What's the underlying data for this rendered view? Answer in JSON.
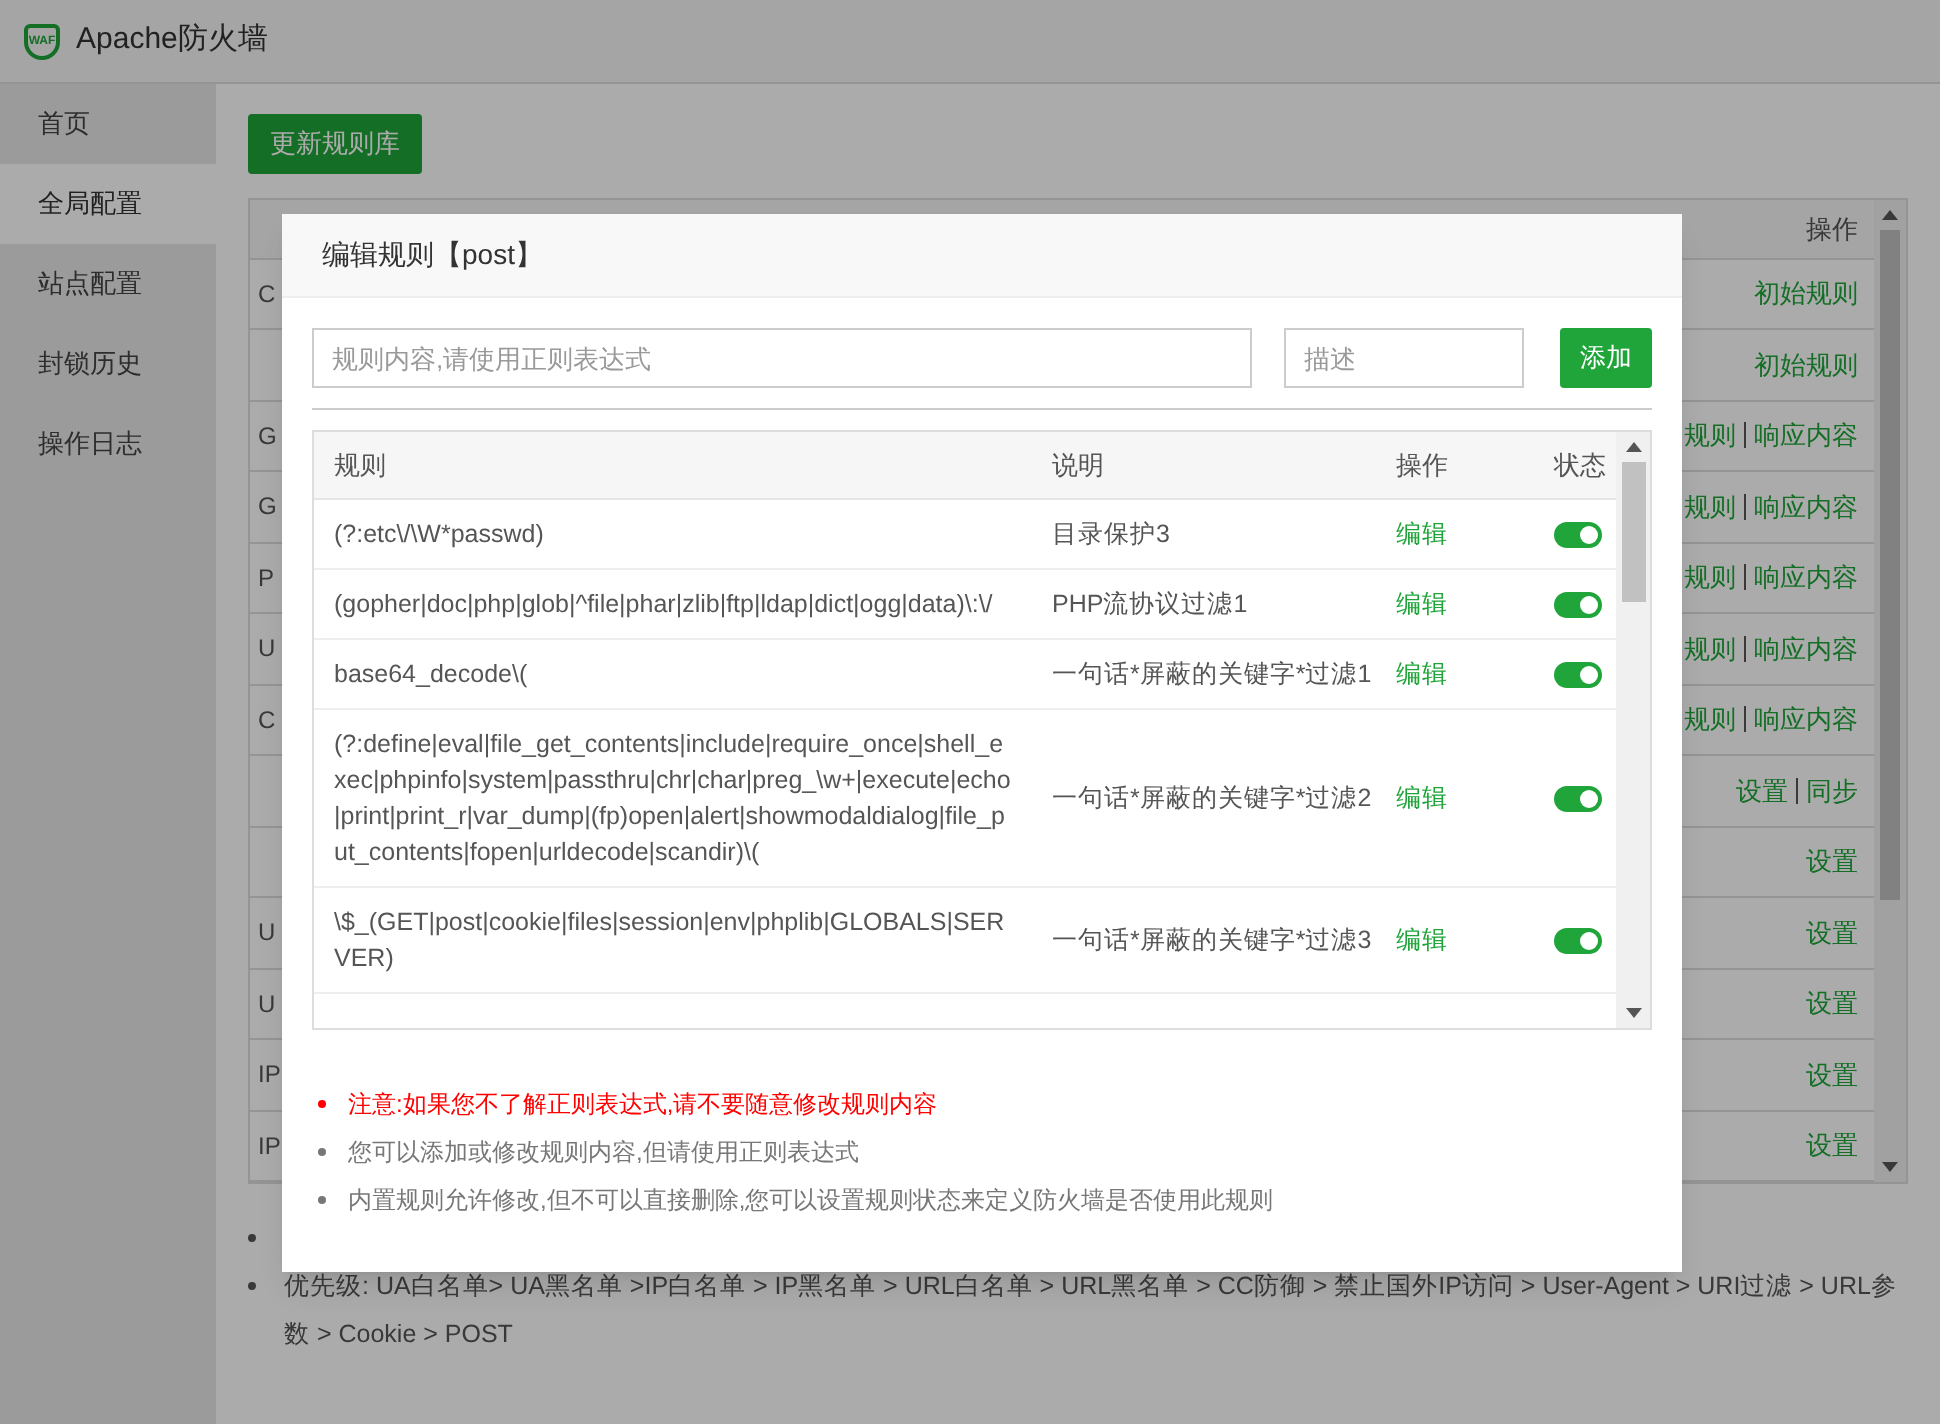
{
  "app": {
    "logo_text": "WAF",
    "title": "Apache防火墙"
  },
  "sidebar": {
    "items": [
      {
        "label": "首页",
        "selected": false
      },
      {
        "label": "全局配置",
        "selected": true
      },
      {
        "label": "站点配置",
        "selected": false
      },
      {
        "label": "封锁历史",
        "selected": false
      },
      {
        "label": "操作日志",
        "selected": false
      }
    ]
  },
  "update_button": "更新规则库",
  "background_table": {
    "columns": [
      "操作"
    ],
    "rows": [
      {
        "name": "C",
        "actions": [
          "初始规则"
        ]
      },
      {
        "actions": [
          "初始规则"
        ]
      },
      {
        "name": "G",
        "actions": [
          "规则",
          "响应内容"
        ]
      },
      {
        "name": "G",
        "actions": [
          "规则",
          "响应内容"
        ]
      },
      {
        "name": "P",
        "actions": [
          "规则",
          "响应内容"
        ]
      },
      {
        "name": "U",
        "actions": [
          "规则",
          "响应内容"
        ]
      },
      {
        "name": "C",
        "actions": [
          "规则",
          "响应内容"
        ]
      },
      {
        "actions": [
          "设置",
          "同步"
        ]
      },
      {
        "actions": [
          "设置"
        ]
      },
      {
        "name": "U",
        "actions": [
          "设置"
        ]
      },
      {
        "name": "U",
        "actions": [
          "设置"
        ]
      },
      {
        "name": "IP",
        "actions": [
          "设置"
        ]
      },
      {
        "name": "IP",
        "actions": [
          "设置"
        ]
      }
    ]
  },
  "footer_notes": [
    "优先级: UA白名单> UA黑名单 >IP白名单 > IP黑名单 > URL白名单 > URL黑名单 > CC防御 > 禁止国外IP访问 > User-Agent > URI过滤 > URL参数 > Cookie > POST"
  ],
  "dialog": {
    "title": "编辑规则【post】",
    "rule_field": {
      "placeholder": "规则内容,请使用正则表达式"
    },
    "desc_field": {
      "placeholder": "描述"
    },
    "add_button": "添加",
    "columns": [
      "规则",
      "说明",
      "操作",
      "状态"
    ],
    "rules": [
      {
        "rule": "(?:etc\\/\\W*passwd)",
        "desc": "目录保护3",
        "action": "编辑",
        "on": true
      },
      {
        "rule": "(gopher|doc|php|glob|^file|phar|zlib|ftp|ldap|dict|ogg|data)\\:\\/",
        "desc": "PHP流协议过滤1",
        "action": "编辑",
        "on": true
      },
      {
        "rule": "base64_decode\\(",
        "desc": "一句话*屏蔽的关键字*过滤1",
        "action": "编辑",
        "on": true
      },
      {
        "rule": "(?:define|eval|file_get_contents|include|require_once|shell_exec|phpinfo|system|passthru|chr|char|preg_\\w+|execute|echo|print|print_r|var_dump|(fp)open|alert|showmodaldialog|file_put_contents|fopen|urldecode|scandir)\\(",
        "desc": "一句话*屏蔽的关键字*过滤2",
        "action": "编辑",
        "on": true
      },
      {
        "rule": "\\$_(GET|post|cookie|files|session|env|phplib|GLOBALS|SERVER)",
        "desc": "一句话*屏蔽的关键字*过滤3",
        "action": "编辑",
        "on": true
      }
    ],
    "notes": [
      {
        "kind": "warning",
        "text": "注意:如果您不了解正则表达式,请不要随意修改规则内容"
      },
      {
        "kind": "info",
        "text": "您可以添加或修改规则内容,但请使用正则表达式"
      },
      {
        "kind": "info",
        "text": "内置规则允许修改,但不可以直接删除,您可以设置规则状态来定义防火墙是否使用此规则"
      }
    ]
  }
}
